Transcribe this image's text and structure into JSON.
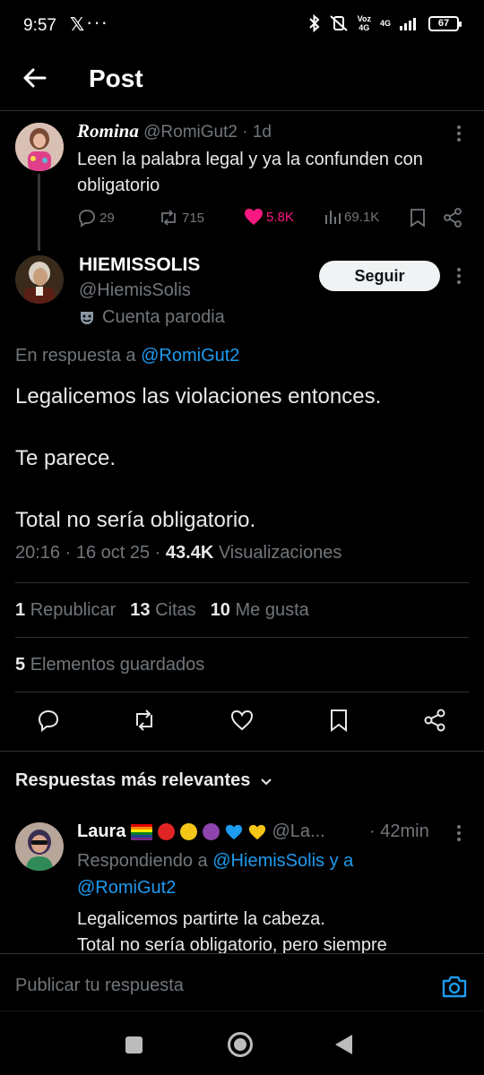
{
  "status_bar": {
    "time": "9:57",
    "x_icon": "x-logo-icon",
    "dots": "···",
    "voz_label": "Voz",
    "net_label": "4G",
    "lte_label": "4G",
    "battery": "67"
  },
  "header": {
    "title": "Post",
    "back_icon": "arrow-left-icon"
  },
  "parent_tweet": {
    "name": "Romina",
    "handle": "@RomiGut2",
    "time": "· 1d",
    "text": "Leen la palabra legal y ya la confunden con obligatorio",
    "replies": "29",
    "reposts": "715",
    "likes": "5.8K",
    "views": "69.1K"
  },
  "main_tweet": {
    "name": "HIEMISSOLIS",
    "handle": "@HiemisSolis",
    "parody_label": "Cuenta parodia",
    "follow_label": "Seguir",
    "reply_prefix": "En respuesta a",
    "reply_handle": "@RomiGut2",
    "body": [
      "Legalicemos las violaciones entonces.",
      "Te parece.",
      "Total no sería obligatorio."
    ],
    "time": "20:16 · 16 oct 25 ·",
    "views_count": "43.4K",
    "views_label": "Visualizaciones",
    "reposts_count": "1",
    "reposts_label": "Republicar",
    "quotes_count": "13",
    "quotes_label": "Citas",
    "likes_count": "10",
    "likes_label": "Me gusta",
    "bookmarks_count": "5",
    "bookmarks_label": "Elementos guardados"
  },
  "replies_sort_label": "Respuestas más relevantes",
  "reply": {
    "name": "Laura",
    "handle": "@La...",
    "time": "· 42min",
    "replying_prefix": "Respondiendo a",
    "replying_handles": "@HiemisSolis y a @RomiGut2",
    "text_lines": [
      "Legalicemos partirte la cabeza.",
      "Total no sería obligatorio, pero siempre"
    ],
    "emoji_colors": [
      "#e02424",
      "#f5c518",
      "#8e44ad",
      "#1d9bf0",
      "#f5c518"
    ]
  },
  "compose": {
    "placeholder": "Publicar tu respuesta"
  },
  "colors": {
    "background": "#000000",
    "accent": "#1d9bf0",
    "like": "#f91880",
    "secondary_text": "#71767b",
    "divider": "#2f3336"
  }
}
